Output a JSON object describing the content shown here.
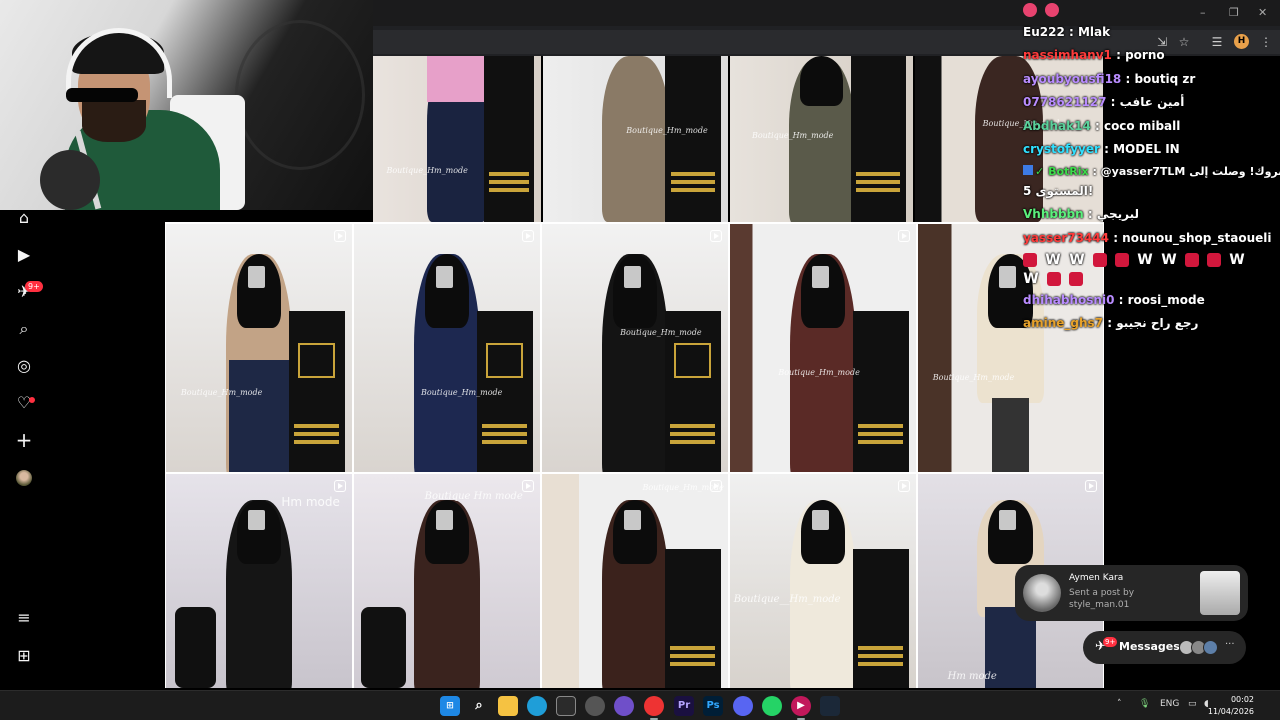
{
  "browser": {
    "window_controls": [
      "–",
      "❐",
      "✕"
    ],
    "toolbar_icons": [
      "install-icon",
      "star-icon",
      "reading-list-icon"
    ],
    "profile_initial": "H",
    "menu": "⋮"
  },
  "sidebar": {
    "items": [
      {
        "name": "home",
        "glyph": "⌂"
      },
      {
        "name": "reels",
        "glyph": "▶"
      },
      {
        "name": "messages",
        "glyph": "✈"
      },
      {
        "name": "search",
        "glyph": "⌕"
      },
      {
        "name": "explore",
        "glyph": "◎"
      },
      {
        "name": "notifications",
        "glyph": "♡"
      },
      {
        "name": "create",
        "glyph": "+"
      },
      {
        "name": "more",
        "glyph": "≡"
      },
      {
        "name": "also-from-meta",
        "glyph": "⊞"
      }
    ],
    "messages_badge": "9+"
  },
  "grid": {
    "top_row_watermarks": [
      "Boutique_Hm_mode",
      "Boutique_Hm_mode",
      "Boutique_Hm_mode",
      "Boutique_Hm_mode"
    ],
    "row1_watermarks": [
      "Boutique_Hm_mode",
      "Boutique_Hm_mode",
      "Boutique_Hm_mode",
      "Boutique_Hm_mode",
      "Boutique_Hm_mode"
    ],
    "row2_watermarks": [
      "Hm mode",
      "Boutique Hm mode",
      "Boutique_Hm_mode",
      "Boutique__Hm_mode",
      "Hm mode"
    ]
  },
  "chat": {
    "lines": [
      {
        "user": "",
        "text": "",
        "emotes": "hearts"
      },
      {
        "user": "Eu222",
        "color": "#ffffff",
        "text": "Mlak"
      },
      {
        "user": "nassimhanv1",
        "color": "#ff3b3b",
        "text": "porno"
      },
      {
        "user": "ayoubyousfi18",
        "color": "#b98cff",
        "text": "boutiq zr"
      },
      {
        "user": "0778621127",
        "color": "#b98cff",
        "text": "أمين عافب"
      },
      {
        "user": "Abdhak14",
        "color": "#5ad19b",
        "text": "coco miball"
      },
      {
        "user": "crystofyyer",
        "color": "#30e0ff",
        "text": "MODEL IN"
      },
      {
        "user": "BotRix",
        "color": "#3ddc4b",
        "text": "@yasser7TLM مبروك! وصلت إلى"
      },
      {
        "user": "",
        "color": "#ffffff",
        "text": "المستوى 5!"
      },
      {
        "user": "Vhhbbbn",
        "color": "#5bf17c",
        "text": "لبريجي"
      },
      {
        "user": "yasser73444",
        "color": "#ff3b3b",
        "text": "nounou_shop_staoueli"
      },
      {
        "user": "dhihabhosni0",
        "color": "#b98cff",
        "text": "roosi_mode"
      },
      {
        "user": "amine_ghs7",
        "color": "#e7a22b",
        "text": "رجع راح نجيبو"
      }
    ]
  },
  "notification": {
    "name": "Aymen Kara",
    "line1": "Sent a post by",
    "line2": "style_man.01"
  },
  "messages_pill": {
    "label": "Messages",
    "badge": "9+",
    "more": "···"
  },
  "taskbar": {
    "lang": "ENG",
    "time": "00:02",
    "date": "11/04/2026"
  }
}
